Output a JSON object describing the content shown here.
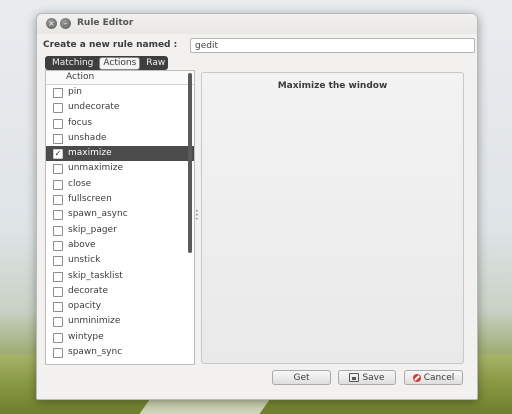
{
  "window": {
    "title": "Rule Editor"
  },
  "form": {
    "name_label": "Create a new rule named :",
    "name_value": "gedit"
  },
  "tabs": [
    {
      "label": "Matching",
      "active": false
    },
    {
      "label": "Actions",
      "active": true
    },
    {
      "label": "Raw",
      "active": false
    }
  ],
  "list": {
    "column_header": "Action",
    "rows": [
      {
        "label": "pin",
        "checked": false,
        "selected": false
      },
      {
        "label": "undecorate",
        "checked": false,
        "selected": false
      },
      {
        "label": "focus",
        "checked": false,
        "selected": false
      },
      {
        "label": "unshade",
        "checked": false,
        "selected": false
      },
      {
        "label": "maximize",
        "checked": true,
        "selected": true
      },
      {
        "label": "unmaximize",
        "checked": false,
        "selected": false
      },
      {
        "label": "close",
        "checked": false,
        "selected": false
      },
      {
        "label": "fullscreen",
        "checked": false,
        "selected": false
      },
      {
        "label": "spawn_async",
        "checked": false,
        "selected": false
      },
      {
        "label": "skip_pager",
        "checked": false,
        "selected": false
      },
      {
        "label": "above",
        "checked": false,
        "selected": false
      },
      {
        "label": "unstick",
        "checked": false,
        "selected": false
      },
      {
        "label": "skip_tasklist",
        "checked": false,
        "selected": false
      },
      {
        "label": "decorate",
        "checked": false,
        "selected": false
      },
      {
        "label": "opacity",
        "checked": false,
        "selected": false
      },
      {
        "label": "unminimize",
        "checked": false,
        "selected": false
      },
      {
        "label": "wintype",
        "checked": false,
        "selected": false
      },
      {
        "label": "spawn_sync",
        "checked": false,
        "selected": false
      }
    ]
  },
  "detail": {
    "title": "Maximize the window"
  },
  "buttons": {
    "get": "Get",
    "save": "Save",
    "cancel": "Cancel"
  },
  "icons": {
    "close": "close-icon",
    "minimize": "minimize-icon",
    "save": "floppy-icon",
    "cancel": "no-entry-icon"
  }
}
